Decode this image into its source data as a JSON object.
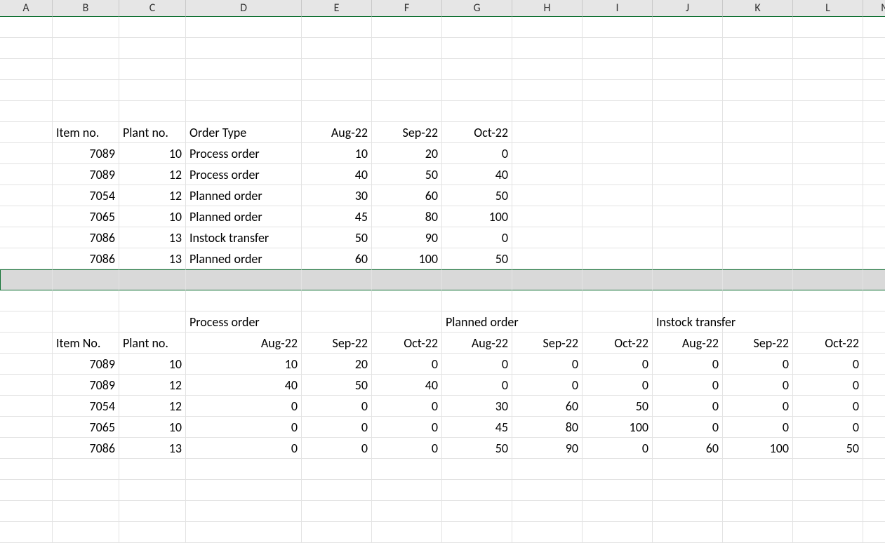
{
  "columns": [
    "A",
    "B",
    "C",
    "D",
    "E",
    "F",
    "G",
    "H",
    "I",
    "J",
    "K",
    "L",
    "M"
  ],
  "sheet": {
    "headers": {
      "item_no": "Item no.",
      "plant_no": "Plant no.",
      "order_type": "Order Type",
      "aug22": "Aug-22",
      "sep22": "Sep-22",
      "oct22": "Oct-22"
    },
    "table1_rows": [
      {
        "item_no": "7089",
        "plant_no": "10",
        "order_type": "Process order",
        "aug": "10",
        "sep": "20",
        "oct": "0"
      },
      {
        "item_no": "7089",
        "plant_no": "12",
        "order_type": "Process order",
        "aug": "40",
        "sep": "50",
        "oct": "40"
      },
      {
        "item_no": "7054",
        "plant_no": "12",
        "order_type": "Planned order",
        "aug": "30",
        "sep": "60",
        "oct": "50"
      },
      {
        "item_no": "7065",
        "plant_no": "10",
        "order_type": "Planned order",
        "aug": "45",
        "sep": "80",
        "oct": "100"
      },
      {
        "item_no": "7086",
        "plant_no": "13",
        "order_type": "Instock transfer",
        "aug": "50",
        "sep": "90",
        "oct": "0"
      },
      {
        "item_no": "7086",
        "plant_no": "13",
        "order_type": "Planned order",
        "aug": "60",
        "sep": "100",
        "oct": "50"
      }
    ],
    "table2": {
      "group_labels": {
        "process": "Process order",
        "planned": "Planned order",
        "instock": "Instock transfer"
      },
      "col_headers": {
        "item_no": "Item No.",
        "plant_no": "Plant no.",
        "aug22": "Aug-22",
        "sep22": "Sep-22",
        "oct22": "Oct-22"
      },
      "rows": [
        {
          "item_no": "7089",
          "plant_no": "10",
          "p_aug": "10",
          "p_sep": "20",
          "p_oct": "0",
          "pl_aug": "0",
          "pl_sep": "0",
          "pl_oct": "0",
          "in_aug": "0",
          "in_sep": "0",
          "in_oct": "0"
        },
        {
          "item_no": "7089",
          "plant_no": "12",
          "p_aug": "40",
          "p_sep": "50",
          "p_oct": "40",
          "pl_aug": "0",
          "pl_sep": "0",
          "pl_oct": "0",
          "in_aug": "0",
          "in_sep": "0",
          "in_oct": "0"
        },
        {
          "item_no": "7054",
          "plant_no": "12",
          "p_aug": "0",
          "p_sep": "0",
          "p_oct": "0",
          "pl_aug": "30",
          "pl_sep": "60",
          "pl_oct": "50",
          "in_aug": "0",
          "in_sep": "0",
          "in_oct": "0"
        },
        {
          "item_no": "7065",
          "plant_no": "10",
          "p_aug": "0",
          "p_sep": "0",
          "p_oct": "0",
          "pl_aug": "45",
          "pl_sep": "80",
          "pl_oct": "100",
          "in_aug": "0",
          "in_sep": "0",
          "in_oct": "0"
        },
        {
          "item_no": "7086",
          "plant_no": "13",
          "p_aug": "0",
          "p_sep": "0",
          "p_oct": "0",
          "pl_aug": "50",
          "pl_sep": "90",
          "pl_oct": "0",
          "in_aug": "60",
          "in_sep": "100",
          "in_oct": "50"
        }
      ]
    }
  }
}
